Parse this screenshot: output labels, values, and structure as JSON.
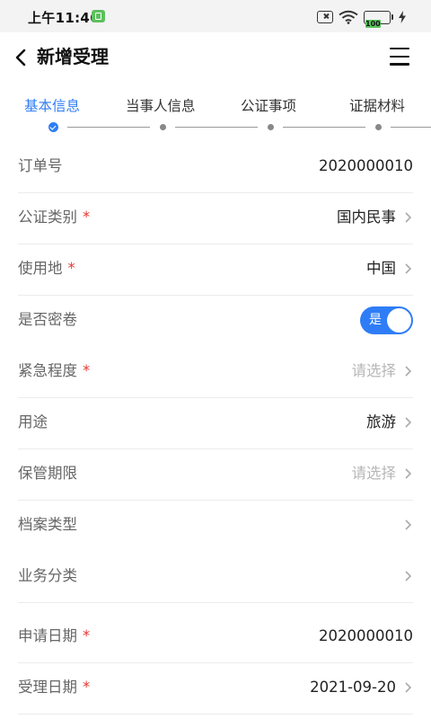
{
  "status_bar": {
    "time": "上午11:46",
    "battery": "100"
  },
  "header": {
    "title": "新增受理"
  },
  "steps": [
    {
      "label": "基本信息",
      "active": true
    },
    {
      "label": "当事人信息",
      "active": false
    },
    {
      "label": "公证事项",
      "active": false
    },
    {
      "label": "证据材料",
      "active": false
    }
  ],
  "form": {
    "rows": [
      {
        "label": "订单号",
        "required": false,
        "value": "2020000010"
      },
      {
        "label": "公证类别",
        "required": true,
        "value": "国内民事"
      },
      {
        "label": "使用地",
        "required": true,
        "value": "中国"
      },
      {
        "label": "是否密卷",
        "required": false,
        "toggle_text": "是",
        "toggle_on": true
      },
      {
        "label": "紧急程度",
        "required": true,
        "placeholder": "请选择"
      },
      {
        "label": "用途",
        "required": false,
        "value": "旅游"
      },
      {
        "label": "保管期限",
        "required": false,
        "placeholder": "请选择"
      },
      {
        "label": "档案类型",
        "required": false,
        "value": ""
      },
      {
        "label": "业务分类",
        "required": false,
        "value": ""
      },
      {
        "label": "申请日期",
        "required": true,
        "value": "2020000010"
      },
      {
        "label": "受理日期",
        "required": true,
        "value": "2021-09-20"
      }
    ],
    "required_mark": "*"
  },
  "colors": {
    "accent": "#2f7df6",
    "required": "#e53935",
    "placeholder": "#b7b7b7",
    "label": "#666666"
  },
  "icons": {
    "back": "chevron-left-icon",
    "menu": "hamburger-menu-icon",
    "row_arrow": "chevron-right-icon",
    "step_done": "check-circle-icon"
  }
}
